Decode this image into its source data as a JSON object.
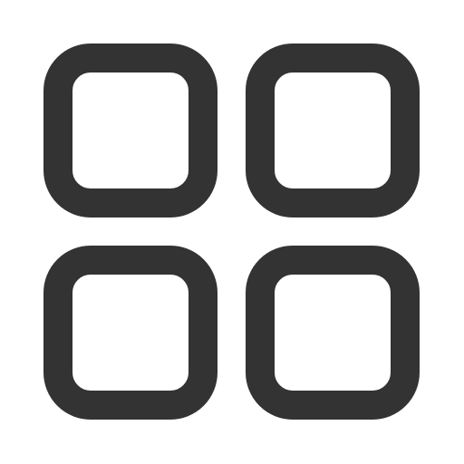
{
  "icon": {
    "name": "grid-icon",
    "stroke_color": "#333333",
    "background_color": "#ffffff",
    "tiles": [
      "top-left",
      "top-right",
      "bottom-left",
      "bottom-right"
    ]
  }
}
